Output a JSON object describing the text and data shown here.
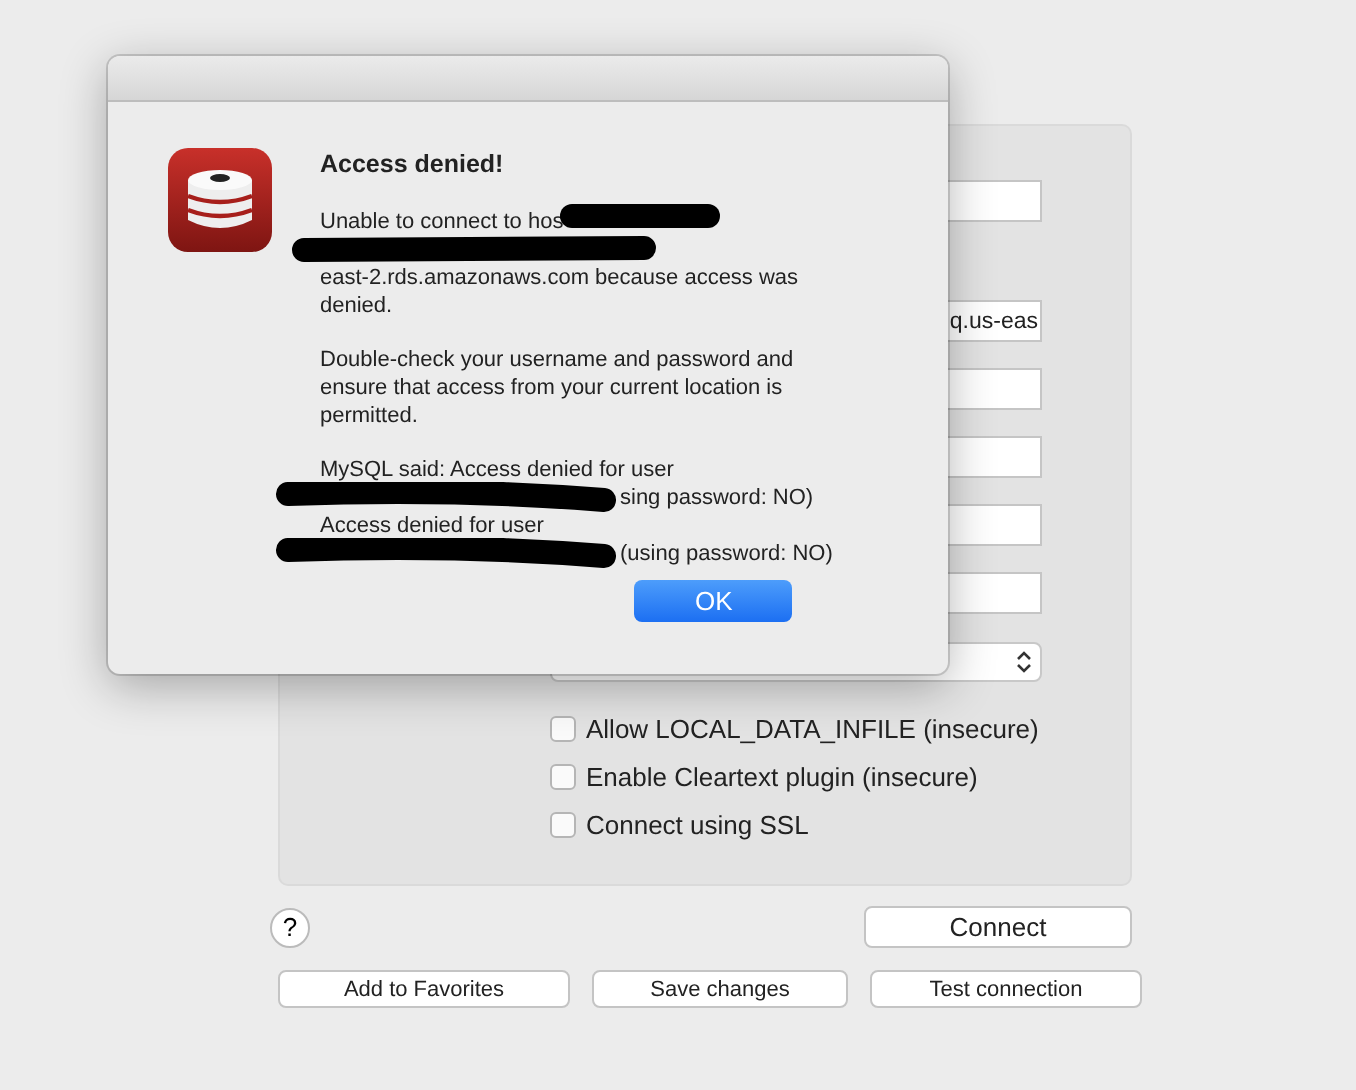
{
  "connection_form": {
    "fields": [
      {
        "kind": "text"
      },
      {
        "kind": "text",
        "value": "q.us-eas"
      },
      {
        "kind": "text"
      },
      {
        "kind": "text"
      },
      {
        "kind": "text"
      },
      {
        "kind": "text"
      },
      {
        "kind": "select"
      }
    ],
    "options": [
      {
        "label": "Allow LOCAL_DATA_INFILE (insecure)",
        "checked": false
      },
      {
        "label": "Enable Cleartext plugin (insecure)",
        "checked": false
      },
      {
        "label": "Connect using SSL",
        "checked": false
      }
    ],
    "help_button": "?",
    "connect_button": "Connect",
    "buttons": [
      "Add to Favorites",
      "Save changes",
      "Test connection"
    ]
  },
  "alert": {
    "title": "Access denied!",
    "paragraphs": [
      [
        {
          "kind": "text_then_redacted",
          "text": "Unable to connect to hos"
        },
        {
          "kind": "redacted"
        },
        {
          "kind": "text",
          "text": "east-2.rds.amazonaws.com because access was"
        },
        {
          "kind": "text",
          "text": "denied."
        }
      ],
      [
        {
          "kind": "text",
          "text": "Double-check your username and password and"
        },
        {
          "kind": "text",
          "text": "ensure that access from your current location is"
        },
        {
          "kind": "text",
          "text": "permitted."
        }
      ],
      [
        {
          "kind": "text",
          "text": "MySQL said: Access denied for user"
        },
        {
          "kind": "redacted_then_text",
          "text": "sing password: NO)"
        },
        {
          "kind": "text",
          "text": "Access denied for user"
        },
        {
          "kind": "redacted_then_text",
          "text": "(using password: NO)"
        }
      ]
    ],
    "ok_button": "OK"
  }
}
